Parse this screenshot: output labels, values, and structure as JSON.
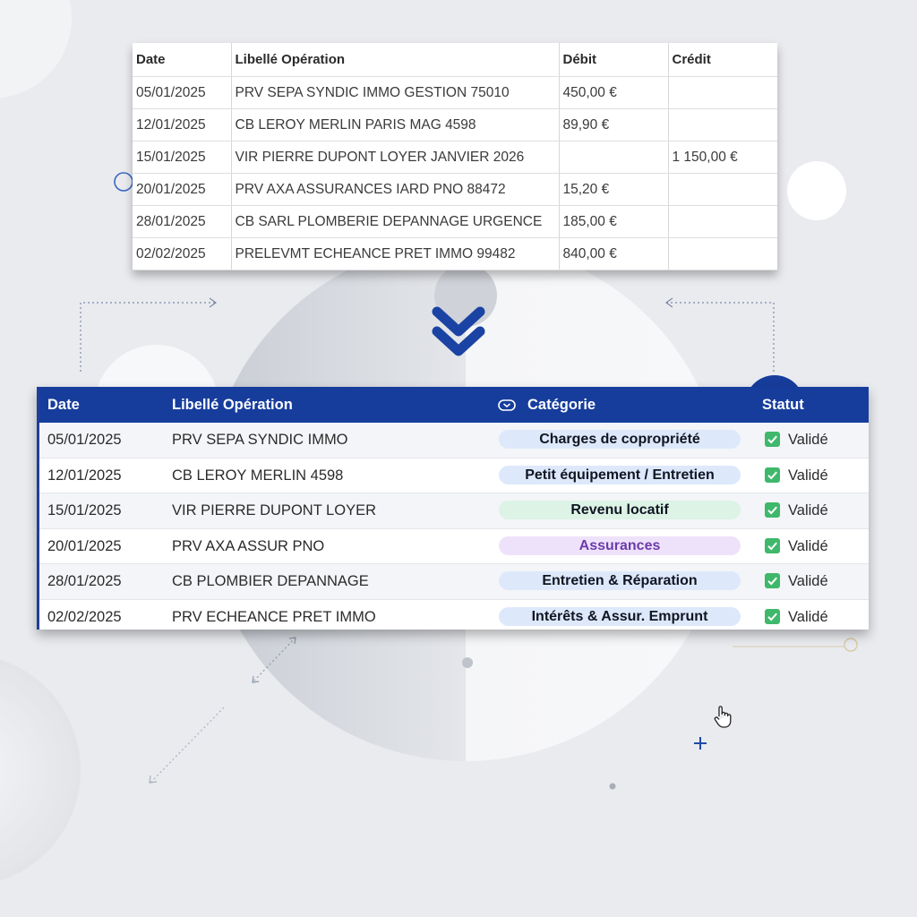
{
  "raw_table": {
    "headers": [
      "Date",
      "Libellé Opération",
      "Débit",
      "Crédit"
    ],
    "rows": [
      [
        "05/01/2025",
        "PRV SEPA SYNDIC IMMO GESTION 75010",
        "450,00 €",
        ""
      ],
      [
        "12/01/2025",
        "CB LEROY MERLIN PARIS MAG 4598",
        "89,90 €",
        ""
      ],
      [
        "15/01/2025",
        "VIR PIERRE DUPONT LOYER JANVIER 2026",
        "",
        "1 150,00 €"
      ],
      [
        "20/01/2025",
        "PRV AXA ASSURANCES IARD PNO 88472",
        "15,20 €",
        ""
      ],
      [
        "28/01/2025",
        "CB SARL PLOMBERIE DEPANNAGE URGENCE",
        "185,00 €",
        ""
      ],
      [
        "02/02/2025",
        "PRELEVMT ECHEANCE PRET IMMO 99482",
        "840,00 €",
        ""
      ]
    ]
  },
  "enriched_table": {
    "headers": {
      "date": "Date",
      "label": "Libellé Opération",
      "category": "Catégorie",
      "status": "Statut"
    },
    "category_icon": "tag-icon",
    "rows": [
      {
        "date": "05/01/2025",
        "label": "PRV SEPA SYNDIC IMMO",
        "category": "Charges de copropriété",
        "category_bg": "#dde9fb",
        "category_color": "#101522",
        "status": "Validé"
      },
      {
        "date": "12/01/2025",
        "label": "CB LEROY MERLIN 4598",
        "category": "Petit équipement / Entretien",
        "category_bg": "#dde9fb",
        "category_color": "#101522",
        "status": "Validé"
      },
      {
        "date": "15/01/2025",
        "label": "VIR PIERRE DUPONT LOYER",
        "category": "Revenu locatif",
        "category_bg": "#dcf3e6",
        "category_color": "#101522",
        "status": "Validé"
      },
      {
        "date": "20/01/2025",
        "label": "PRV AXA ASSUR PNO",
        "category": "Assurances",
        "category_bg": "#eee2fb",
        "category_color": "#6b3bab",
        "status": "Validé"
      },
      {
        "date": "28/01/2025",
        "label": "CB PLOMBIER DEPANNAGE",
        "category": "Entretien & Réparation",
        "category_bg": "#dde9fb",
        "category_color": "#101522",
        "status": "Validé"
      },
      {
        "date": "02/02/2025",
        "label": "PRV ECHEANCE PRET IMMO",
        "category": "Intérêts & Assur. Emprunt",
        "category_bg": "#dde9fb",
        "category_color": "#101522",
        "status": "Validé"
      }
    ],
    "status_icon": "check-icon"
  },
  "colors": {
    "header_bg": "#173d9c",
    "accent": "#1f4aa8",
    "check": "#3fb86b",
    "background": "#e9ebef"
  },
  "icons": [
    "double-chevron-down-icon",
    "hand-cursor-icon",
    "plus-icon",
    "tag-icon",
    "check-icon"
  ]
}
